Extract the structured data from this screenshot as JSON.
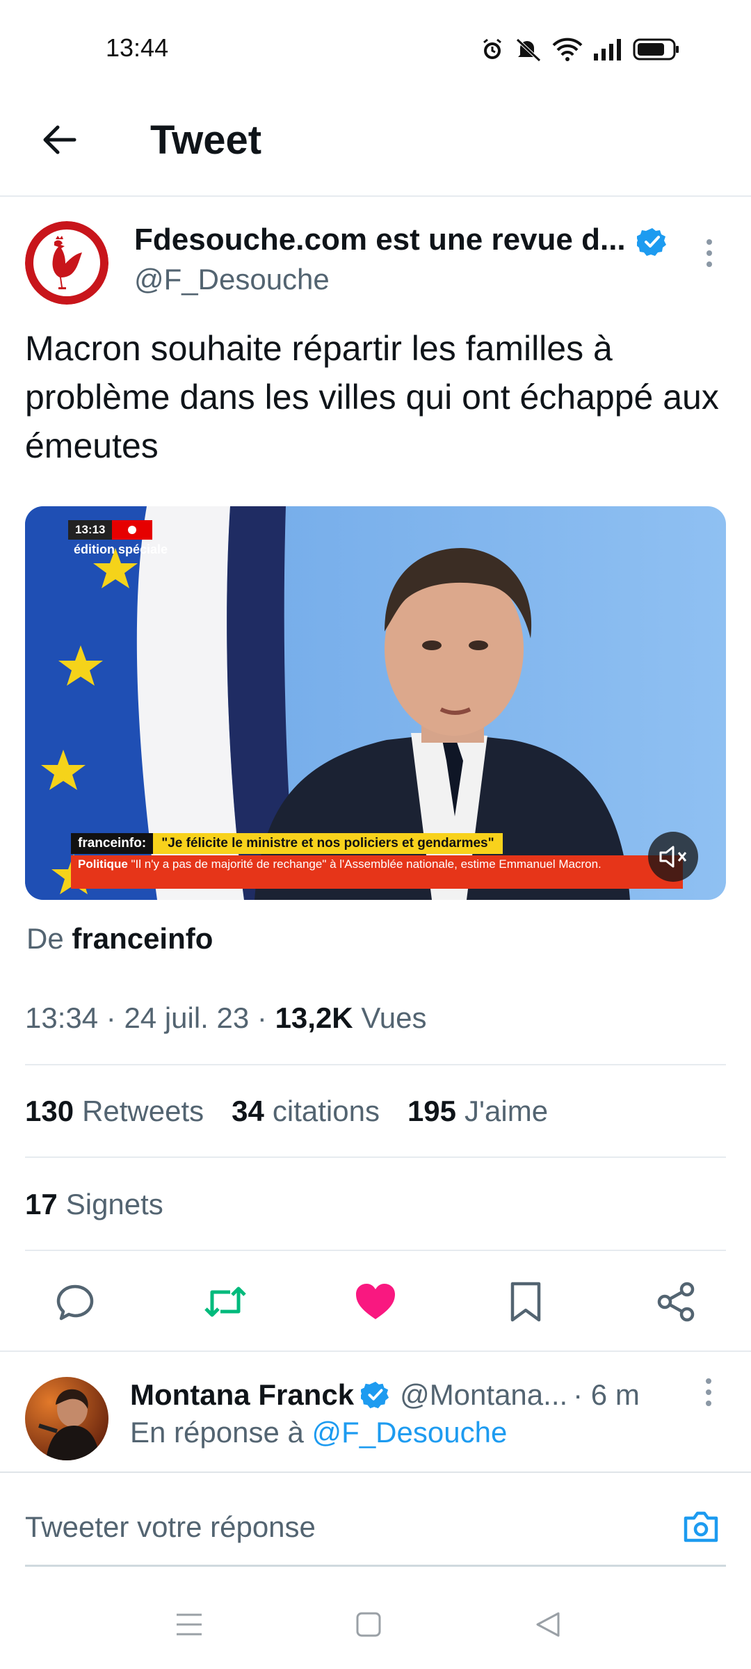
{
  "status_bar": {
    "time": "13:44",
    "icons": [
      "alarm-icon",
      "mute-icon",
      "wifi-icon",
      "signal-icon",
      "battery-icon"
    ]
  },
  "header": {
    "title": "Tweet",
    "back_icon": "arrow-left-icon"
  },
  "tweet": {
    "author_name": "Fdesouche.com est une revue d...",
    "author_handle": "@F_Desouche",
    "text": "Macron souhaite répartir les familles à problème dans les villes qui ont échappé aux émeutes",
    "media": {
      "live_time": "13:13",
      "edition": "édition spéciale",
      "ticker_source": "franceinfo:",
      "ticker_quote": "\"Je félicite le ministre et nos policiers et gendarmes\"",
      "ticker_category": "Politique",
      "ticker_text": "\"Il n'y a pas de majorité de rechange\" à l'Assemblée nationale, estime Emmanuel Macron."
    },
    "source_prefix": "De",
    "source_name": "franceinfo",
    "time": "13:34",
    "date": "24 juil. 23",
    "views_count": "13,2K",
    "views_label": "Vues",
    "retweets_count": "130",
    "retweets_label": "Retweets",
    "quotes_count": "34",
    "quotes_label": "citations",
    "likes_count": "195",
    "likes_label": "J'aime",
    "bookmarks_count": "17",
    "bookmarks_label": "Signets"
  },
  "reply": {
    "author_name": "Montana Franck",
    "author_handle": "@Montana...",
    "time": "· 6 m",
    "replying_prefix": "En réponse à",
    "replying_to": "@F_Desouche"
  },
  "composer": {
    "placeholder": "Tweeter votre réponse"
  },
  "colors": {
    "accent": "#1d9bf0",
    "retweet": "#00ba7c",
    "like": "#f91880",
    "secondary_text": "#536471"
  }
}
